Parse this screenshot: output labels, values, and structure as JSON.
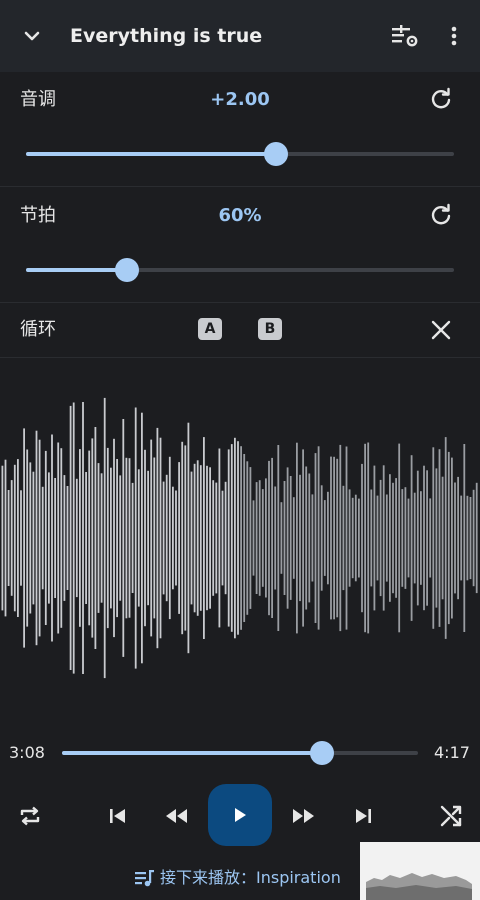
{
  "header": {
    "title": "Everything is true",
    "collapse_icon": "chevron-down-icon",
    "eq_icon": "tune-settings-icon",
    "more_icon": "more-vert-icon"
  },
  "pitch": {
    "label": "音调",
    "value": "+2.00",
    "slider_fraction": 0.585
  },
  "tempo": {
    "label": "节拍",
    "value": "60%",
    "slider_fraction": 0.235
  },
  "loop": {
    "label": "循环",
    "point_a": "A",
    "point_b": "B"
  },
  "waveform": {
    "played_fraction": 0.5
  },
  "progress": {
    "elapsed": "3:08",
    "total": "4:17",
    "fraction": 0.73
  },
  "controls": {
    "repeat_icon": "repeat-icon",
    "prev_icon": "skip-previous-icon",
    "rewind_icon": "fast-rewind-icon",
    "play_icon": "play-icon",
    "forward_icon": "fast-forward-icon",
    "next_icon": "skip-next-icon",
    "shuffle_icon": "shuffle-icon"
  },
  "up_next": {
    "text": "接下来播放：Inspiration"
  },
  "colors": {
    "accent": "#a8cdf5",
    "accent_text": "#9cc6f2",
    "play_button": "#0c4a80",
    "background": "#1c1d20",
    "header_bg": "#23262b"
  }
}
